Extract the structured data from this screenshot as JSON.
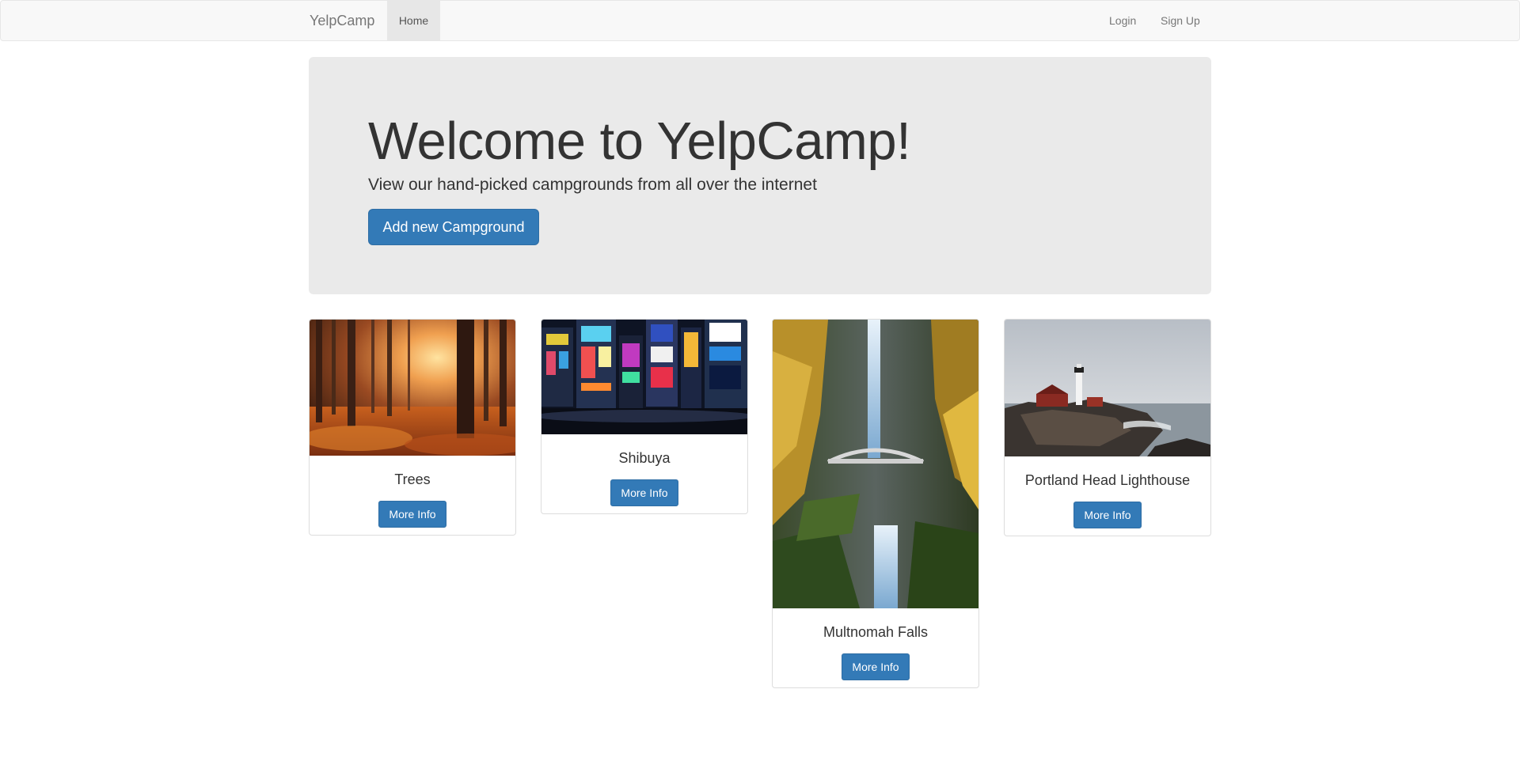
{
  "navbar": {
    "brand": "YelpCamp",
    "home_label": "Home",
    "login_label": "Login",
    "signup_label": "Sign Up"
  },
  "jumbotron": {
    "title": "Welcome to YelpCamp!",
    "subtitle": "View our hand-picked campgrounds from all over the internet",
    "add_button_label": "Add new Campground"
  },
  "campgrounds": [
    {
      "name": "Trees",
      "button_label": "More Info",
      "image": "autumn-forest-photo"
    },
    {
      "name": "Shibuya",
      "button_label": "More Info",
      "image": "city-neon-night-photo"
    },
    {
      "name": "Multnomah Falls",
      "button_label": "More Info",
      "image": "waterfall-bridge-photo"
    },
    {
      "name": "Portland Head Lighthouse",
      "button_label": "More Info",
      "image": "lighthouse-coast-photo"
    }
  ],
  "colors": {
    "primary": "#337ab7",
    "navbar_bg": "#f8f8f8",
    "jumbotron_bg": "#eaeaea"
  }
}
